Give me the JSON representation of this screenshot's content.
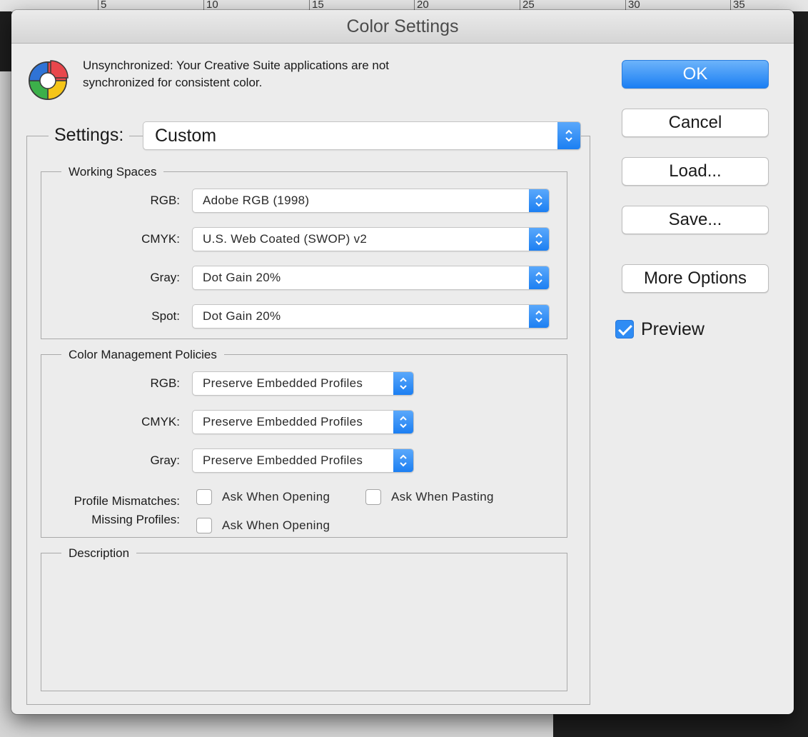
{
  "ruler": {
    "ticks": [
      "5",
      "10",
      "15",
      "20",
      "25",
      "30",
      "35"
    ]
  },
  "dialog": {
    "title": "Color Settings",
    "sync_message_line1": "Unsynchronized: Your Creative Suite applications are not",
    "sync_message_line2": "synchronized for consistent color.",
    "buttons": {
      "ok": "OK",
      "cancel": "Cancel",
      "load": "Load...",
      "save": "Save...",
      "more_options": "More Options"
    },
    "preview": {
      "label": "Preview",
      "checked": true
    },
    "settings": {
      "label": "Settings:",
      "value": "Custom"
    },
    "working_spaces": {
      "title": "Working Spaces",
      "rgb": {
        "label": "RGB:",
        "value": "Adobe RGB (1998)"
      },
      "cmyk": {
        "label": "CMYK:",
        "value": "U.S. Web Coated (SWOP) v2"
      },
      "gray": {
        "label": "Gray:",
        "value": "Dot Gain 20%"
      },
      "spot": {
        "label": "Spot:",
        "value": "Dot Gain 20%"
      }
    },
    "policies": {
      "title": "Color Management Policies",
      "rgb": {
        "label": "RGB:",
        "value": "Preserve Embedded Profiles"
      },
      "cmyk": {
        "label": "CMYK:",
        "value": "Preserve Embedded Profiles"
      },
      "gray": {
        "label": "Gray:",
        "value": "Preserve Embedded Profiles"
      },
      "profile_mismatches": {
        "label": "Profile Mismatches:",
        "ask_when_opening": {
          "label": "Ask When Opening",
          "checked": false
        },
        "ask_when_pasting": {
          "label": "Ask When Pasting",
          "checked": false
        }
      },
      "missing_profiles": {
        "label": "Missing Profiles:",
        "ask_when_opening": {
          "label": "Ask When Opening",
          "checked": false
        }
      }
    },
    "description": {
      "title": "Description"
    }
  },
  "colors": {
    "accent": "#1b7ff3",
    "dialog_bg": "#ececec",
    "logo_red": "#e8474c",
    "logo_yellow": "#f5c518",
    "logo_green": "#3cb04a",
    "logo_blue": "#2f73d6"
  }
}
